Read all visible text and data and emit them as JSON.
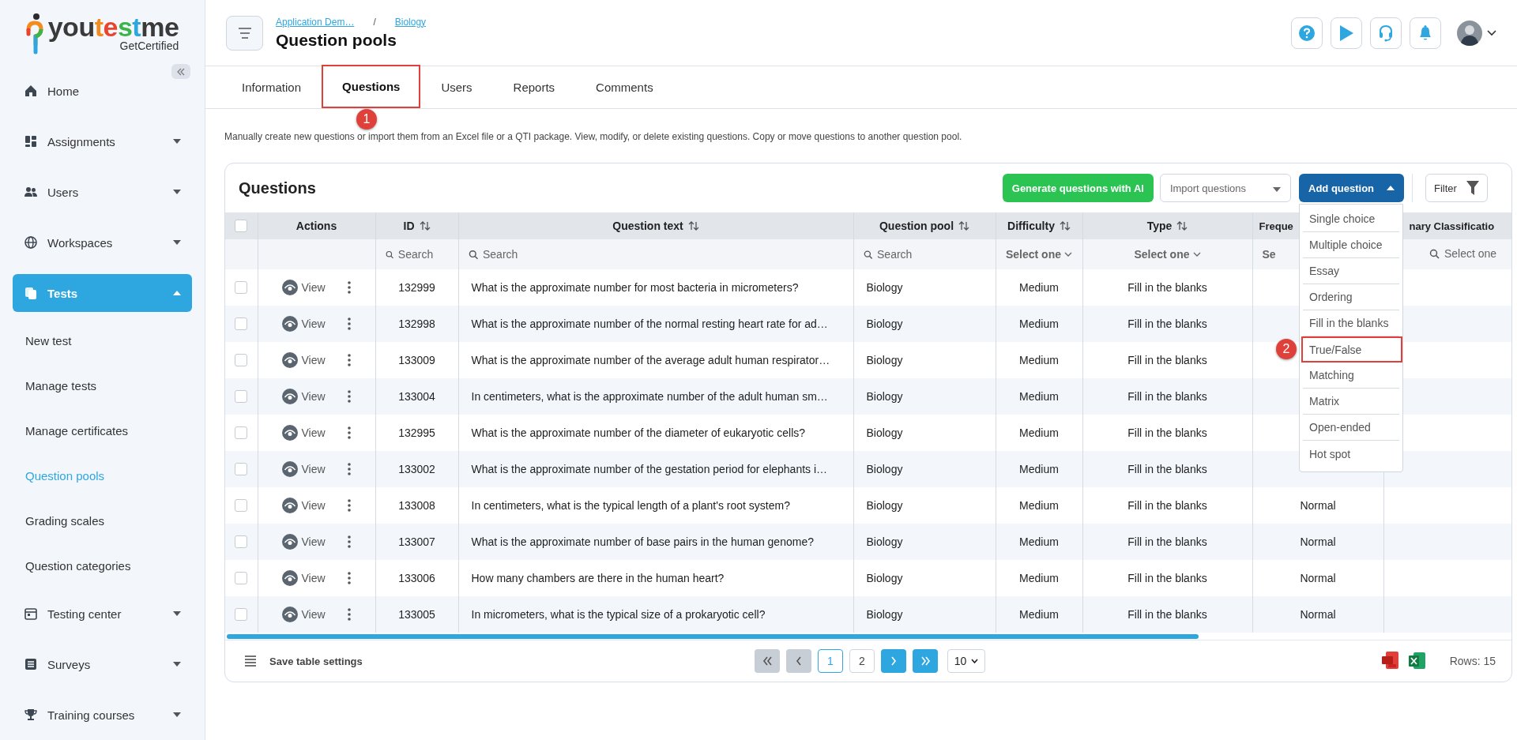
{
  "sidebar": {
    "logo": {
      "parts": [
        {
          "text": "you",
          "color": "#3a3a3a"
        },
        {
          "text": "t",
          "color": "#f28c1e"
        },
        {
          "text": "e",
          "color": "#e8452c"
        },
        {
          "text": "s",
          "color": "#3bb54a"
        },
        {
          "text": "t",
          "color": "#2ea7e0"
        },
        {
          "text": "me",
          "color": "#3a3a3a"
        }
      ],
      "tagline": "GetCertified"
    },
    "items": [
      {
        "kind": "link",
        "label": "Home",
        "selected": false
      },
      {
        "kind": "group",
        "label": "Assignments",
        "selected": false,
        "expanded": false
      },
      {
        "kind": "group",
        "label": "Users",
        "selected": false,
        "expanded": false
      },
      {
        "kind": "group",
        "label": "Workspaces",
        "selected": false,
        "expanded": false
      },
      {
        "kind": "group",
        "label": "Tests",
        "selected": true,
        "expanded": true,
        "children": [
          {
            "label": "New test",
            "selected": false
          },
          {
            "label": "Manage tests",
            "selected": false
          },
          {
            "label": "Manage certificates",
            "selected": false
          },
          {
            "label": "Question pools",
            "selected": true
          },
          {
            "label": "Grading scales",
            "selected": false
          },
          {
            "label": "Question categories",
            "selected": false
          }
        ]
      },
      {
        "kind": "group",
        "label": "Testing center",
        "selected": false,
        "expanded": false
      },
      {
        "kind": "group",
        "label": "Surveys",
        "selected": false,
        "expanded": false
      },
      {
        "kind": "group",
        "label": "Training courses",
        "selected": false,
        "expanded": false
      }
    ]
  },
  "header": {
    "breadcrumbs": [
      "Application Dem…",
      "Biology"
    ],
    "separator": "/",
    "title": "Question pools"
  },
  "tabs": [
    {
      "label": "Information",
      "selected": false
    },
    {
      "label": "Questions",
      "selected": true,
      "callout": "1"
    },
    {
      "label": "Users",
      "selected": false
    },
    {
      "label": "Reports",
      "selected": false
    },
    {
      "label": "Comments",
      "selected": false
    }
  ],
  "description": "Manually create new questions or import them from an Excel file or a QTI package. View, modify, or delete existing questions. Copy or move questions to another question pool.",
  "card": {
    "title": "Questions",
    "buttons": {
      "generate": "Generate questions with AI",
      "import": "Import questions",
      "add": "Add question",
      "filter": "Filter"
    },
    "add_menu": {
      "expanded": true,
      "items": [
        {
          "label": "Single choice"
        },
        {
          "label": "Multiple choice"
        },
        {
          "label": "Essay"
        },
        {
          "label": "Ordering"
        },
        {
          "label": "Fill in the blanks"
        },
        {
          "label": "True/False",
          "callout": "2"
        },
        {
          "label": "Matching"
        },
        {
          "label": "Matrix"
        },
        {
          "label": "Open-ended"
        },
        {
          "label": "Hot spot"
        }
      ]
    }
  },
  "table": {
    "select_all": {
      "checked": false
    },
    "columns": [
      {
        "label": "Actions",
        "sortable": false,
        "filter": {
          "kind": "none"
        }
      },
      {
        "label": "ID",
        "sortable": true,
        "filter": {
          "kind": "search",
          "placeholder": "Search"
        }
      },
      {
        "label": "Question text",
        "sortable": true,
        "filter": {
          "kind": "search",
          "placeholder": "Search"
        }
      },
      {
        "label": "Question pool",
        "sortable": true,
        "filter": {
          "kind": "search",
          "placeholder": "Search"
        }
      },
      {
        "label": "Difficulty",
        "sortable": true,
        "filter": {
          "kind": "select",
          "placeholder": "Select one"
        }
      },
      {
        "label": "Type",
        "sortable": true,
        "filter": {
          "kind": "select",
          "placeholder": "Select one"
        }
      },
      {
        "label": "Freque",
        "sortable": false,
        "filter": {
          "kind": "text",
          "placeholder": "Se"
        }
      },
      {
        "label": "nary Classificatio",
        "sortable": false,
        "filter": {
          "kind": "search",
          "placeholder": "Select one"
        }
      }
    ],
    "rows": [
      {
        "checked": false,
        "view": "View",
        "id": "132999",
        "text": "What is the approximate number for most bacteria in micrometers?",
        "pool": "Biology",
        "difficulty": "Medium",
        "type": "Fill in the blanks"
      },
      {
        "checked": false,
        "view": "View",
        "id": "132998",
        "text": "What is the approximate number of the normal resting heart rate for ad…",
        "pool": "Biology",
        "difficulty": "Medium",
        "type": "Fill in the blanks"
      },
      {
        "checked": false,
        "view": "View",
        "id": "133009",
        "text": "What is the approximate number of the average adult human respirator…",
        "pool": "Biology",
        "difficulty": "Medium",
        "type": "Fill in the blanks"
      },
      {
        "checked": false,
        "view": "View",
        "id": "133004",
        "text": "In centimeters, what is the approximate number of the adult human sm…",
        "pool": "Biology",
        "difficulty": "Medium",
        "type": "Fill in the blanks"
      },
      {
        "checked": false,
        "view": "View",
        "id": "132995",
        "text": "What is the approximate number of the diameter of eukaryotic cells?",
        "pool": "Biology",
        "difficulty": "Medium",
        "type": "Fill in the blanks"
      },
      {
        "checked": false,
        "view": "View",
        "id": "133002",
        "text": "What is the approximate number of the gestation period for elephants i…",
        "pool": "Biology",
        "difficulty": "Medium",
        "type": "Fill in the blanks"
      },
      {
        "checked": false,
        "view": "View",
        "id": "133008",
        "text": "In centimeters, what is the typical length of a plant's root system?",
        "pool": "Biology",
        "difficulty": "Medium",
        "type": "Fill in the blanks",
        "frequency": "Normal"
      },
      {
        "checked": false,
        "view": "View",
        "id": "133007",
        "text": "What is the approximate number of base pairs in the human genome?",
        "pool": "Biology",
        "difficulty": "Medium",
        "type": "Fill in the blanks",
        "frequency": "Normal"
      },
      {
        "checked": false,
        "view": "View",
        "id": "133006",
        "text": "How many chambers are there in the human heart?",
        "pool": "Biology",
        "difficulty": "Medium",
        "type": "Fill in the blanks",
        "frequency": "Normal"
      },
      {
        "checked": false,
        "view": "View",
        "id": "133005",
        "text": "In micrometers, what is the typical size of a prokaryotic cell?",
        "pool": "Biology",
        "difficulty": "Medium",
        "type": "Fill in the blanks",
        "frequency": "Normal"
      }
    ]
  },
  "footer": {
    "save_label": "Save table settings",
    "nav": [
      {
        "kind": "first",
        "disabled": true
      },
      {
        "kind": "prev",
        "disabled": true
      },
      {
        "kind": "next",
        "disabled": false
      },
      {
        "kind": "last",
        "disabled": false
      }
    ],
    "pages": [
      {
        "label": "1",
        "selected": true
      },
      {
        "label": "2",
        "selected": false
      }
    ],
    "page_size": "10",
    "rows_label": "Rows: 15"
  }
}
